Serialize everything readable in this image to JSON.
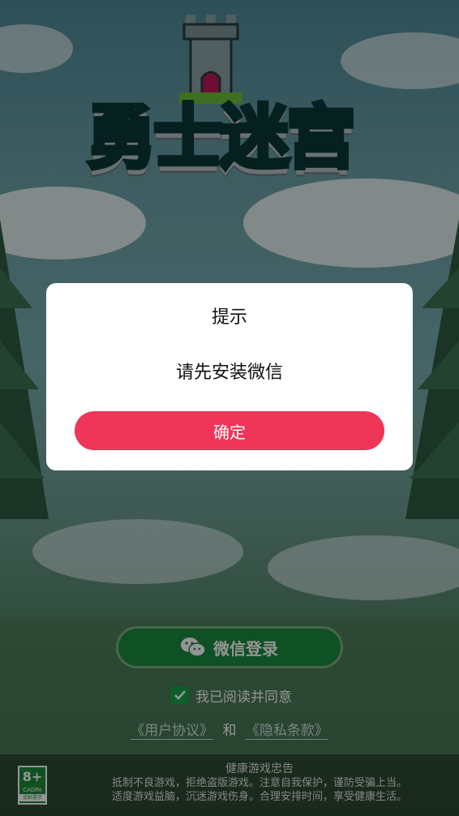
{
  "app": {
    "logo_text": "勇士迷宫"
  },
  "login": {
    "wechat_button_label": "微信登录",
    "agree_text": "我已阅读并同意",
    "user_agreement": "《用户协议》",
    "and": "和",
    "privacy_policy": "《隐私条款》"
  },
  "footer": {
    "age_rating": "8+",
    "age_sub": "CADPA",
    "age_note": "适龄提示",
    "advice_title": "健康游戏忠告",
    "advice_line1": "抵制不良游戏，拒绝盗版游戏。注意自我保护，谨防受骗上当。",
    "advice_line2": "适度游戏益脑，沉迷游戏伤身。合理安排时间，享受健康生活。"
  },
  "dialog": {
    "title": "提示",
    "message": "请先安装微信",
    "confirm_label": "确定"
  },
  "colors": {
    "confirm": "#ef3558",
    "wechat_green": "#1a8a3f",
    "checkbox": "#16a34a"
  },
  "icons": {
    "wechat": "wechat-icon",
    "check": "check-icon"
  }
}
